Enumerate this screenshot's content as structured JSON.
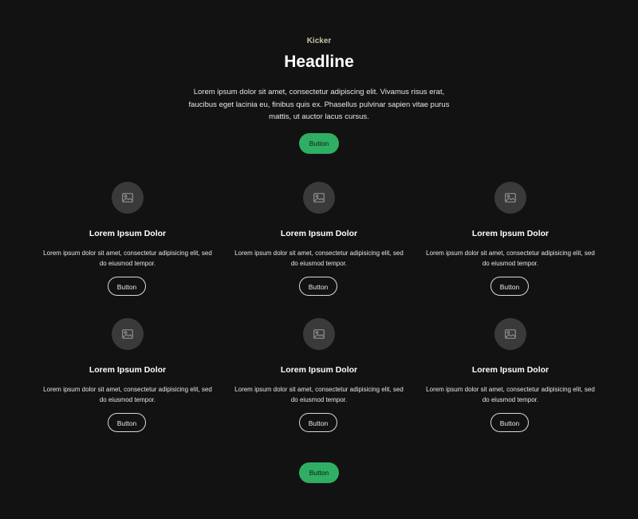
{
  "hero": {
    "kicker": "Kicker",
    "headline": "Headline",
    "intro": "Lorem ipsum dolor sit amet, consectetur adipiscing elit. Vivamus risus erat, faucibus eget lacinia eu, finibus quis ex. Phasellus pulvinar sapien vitae purus mattis, ut auctor lacus cursus.",
    "button_label": "Button"
  },
  "cards": [
    {
      "icon": "image-icon",
      "title": "Lorem Ipsum Dolor",
      "text": "Lorem ipsum dolor sit amet, consectetur adipisicing elit, sed do eiusmod tempor.",
      "button_label": "Button"
    },
    {
      "icon": "image-icon",
      "title": "Lorem Ipsum Dolor",
      "text": "Lorem ipsum dolor sit amet, consectetur adipisicing elit, sed do eiusmod tempor.",
      "button_label": "Button"
    },
    {
      "icon": "image-icon",
      "title": "Lorem Ipsum Dolor",
      "text": "Lorem ipsum dolor sit amet, consectetur adipisicing elit, sed do eiusmod tempor.",
      "button_label": "Button"
    },
    {
      "icon": "image-icon",
      "title": "Lorem Ipsum Dolor",
      "text": "Lorem ipsum dolor sit amet, consectetur adipisicing elit, sed do eiusmod tempor.",
      "button_label": "Button"
    },
    {
      "icon": "image-icon",
      "title": "Lorem Ipsum Dolor",
      "text": "Lorem ipsum dolor sit amet, consectetur adipisicing elit, sed do eiusmod tempor.",
      "button_label": "Button"
    },
    {
      "icon": "image-icon",
      "title": "Lorem Ipsum Dolor",
      "text": "Lorem ipsum dolor sit amet, consectetur adipisicing elit, sed do eiusmod tempor.",
      "button_label": "Button"
    }
  ],
  "footer": {
    "button_label": "Button"
  },
  "colors": {
    "background": "#121212",
    "accent": "#2fae64",
    "kicker": "#c8c3a6",
    "icon_circle": "#3a3a3a"
  }
}
